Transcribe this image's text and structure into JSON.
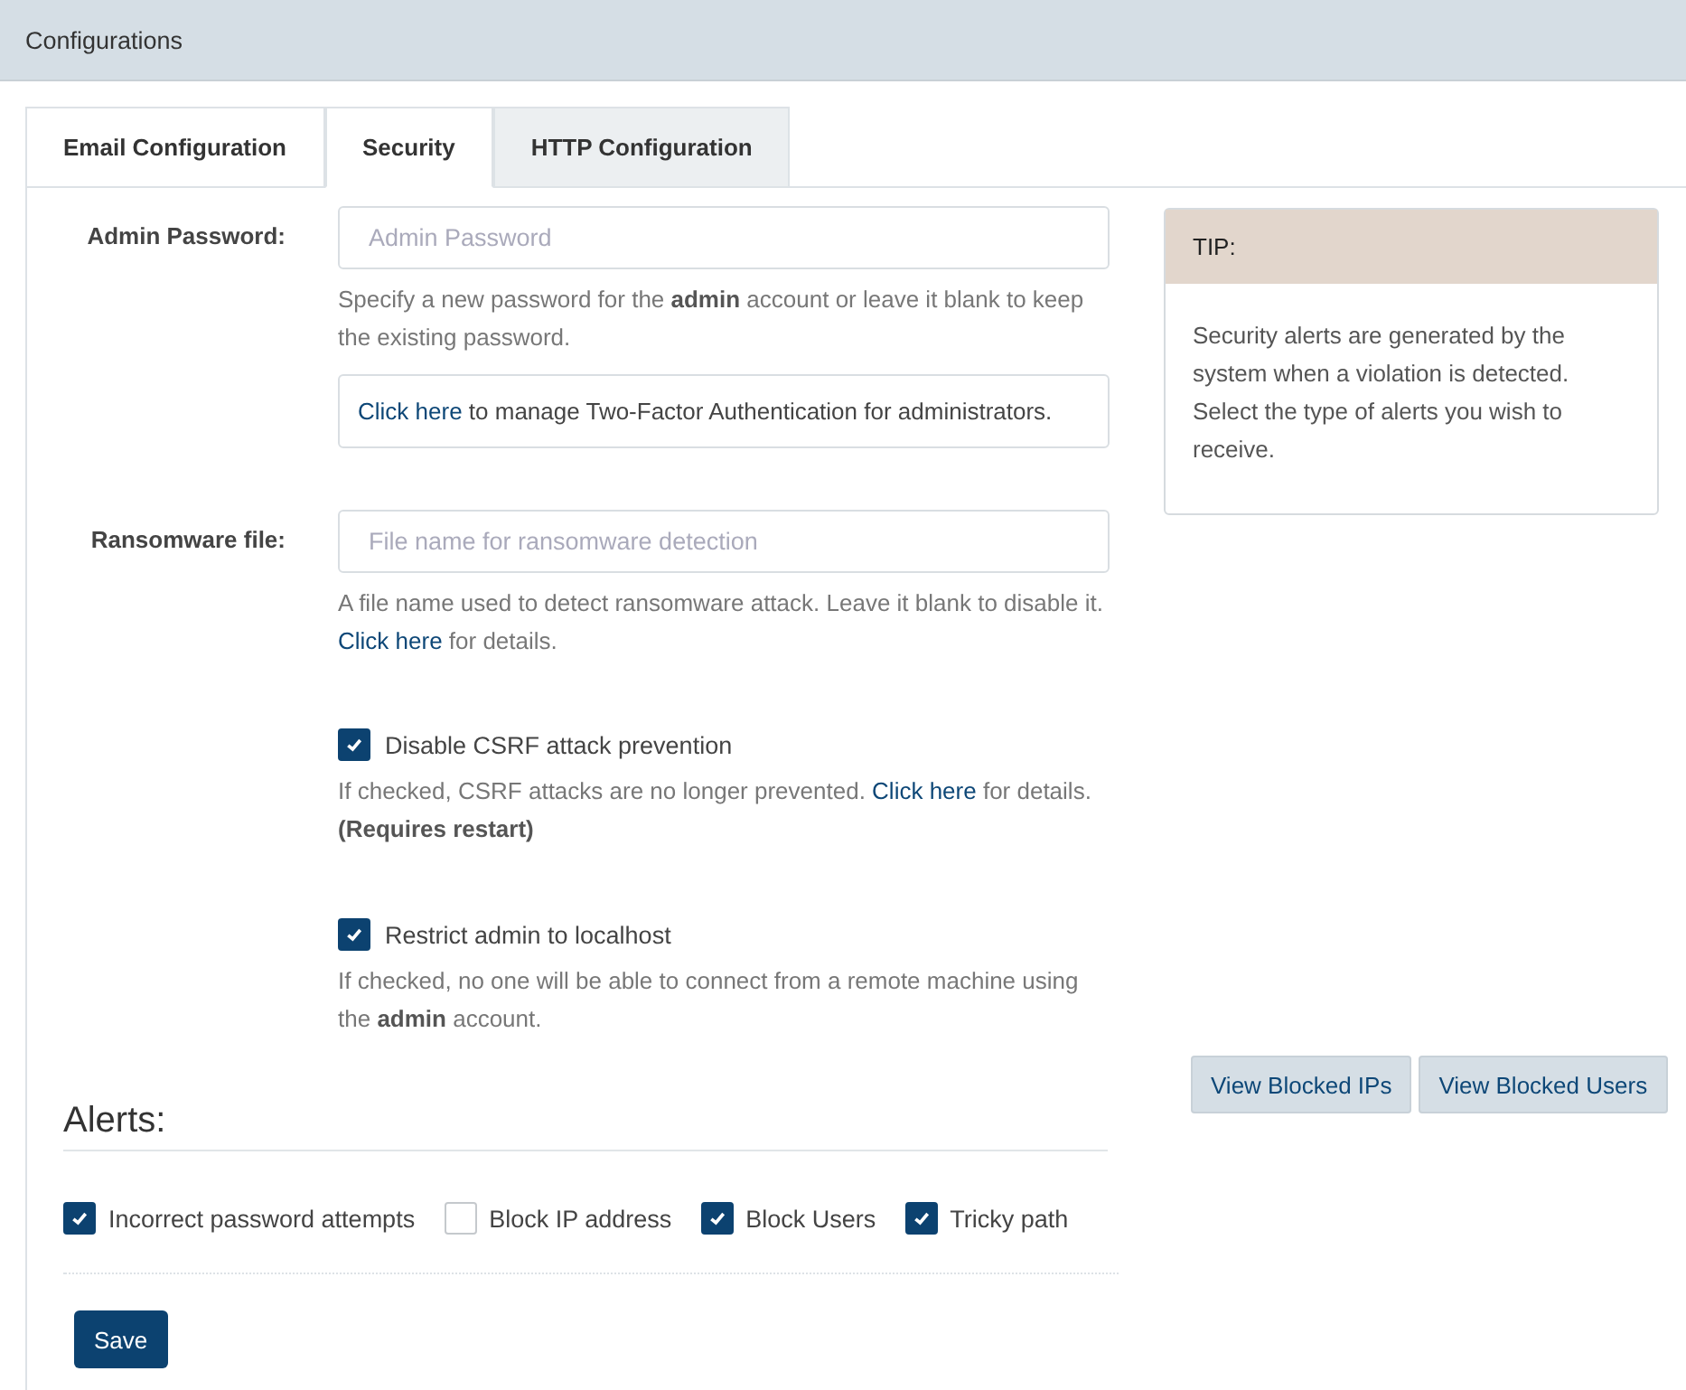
{
  "header": {
    "title": "Configurations"
  },
  "tabs": [
    {
      "label": "Email Configuration",
      "selected": false
    },
    {
      "label": "Security",
      "selected": true
    },
    {
      "label": "HTTP Configuration",
      "selected": false
    }
  ],
  "fields": [
    {
      "kind": "input",
      "label": "Admin Password:",
      "placeholder": "Admin Password",
      "help": [
        {
          "kind": "text",
          "text": "Specify a new password for the **admin** account or leave it blank to keep the existing password."
        }
      ],
      "notice": [
        {
          "kind": "link",
          "text": "Click here"
        },
        {
          "kind": "text",
          "text": " to manage Two-Factor Authentication for administrators."
        }
      ]
    },
    {
      "kind": "input",
      "label": "Ransomware file:",
      "placeholder": "File name for ransomware detection",
      "help": [
        {
          "kind": "text",
          "text": "A file name used to detect ransomware attack. Leave it blank to disable it. "
        },
        {
          "kind": "link",
          "text": "Click here"
        },
        {
          "kind": "text",
          "text": " for details."
        }
      ]
    },
    {
      "kind": "checkbox",
      "label": "Disable CSRF attack prevention",
      "checked": true,
      "help": [
        {
          "kind": "text",
          "text": "If checked, CSRF attacks are no longer prevented. "
        },
        {
          "kind": "link",
          "text": "Click here"
        },
        {
          "kind": "text",
          "text": " for details. **(Requires restart)**"
        }
      ]
    },
    {
      "kind": "checkbox",
      "label": "Restrict admin to localhost",
      "checked": true,
      "help": [
        {
          "kind": "text",
          "text": "If checked, no one will be able to connect from a remote machine using the **admin** account."
        }
      ]
    }
  ],
  "alerts": {
    "title": "Alerts:",
    "options": [
      {
        "label": "Incorrect password attempts",
        "checked": true
      },
      {
        "label": "Block IP address",
        "checked": false
      },
      {
        "label": "Block Users",
        "checked": true
      },
      {
        "label": "Tricky path",
        "checked": true
      }
    ]
  },
  "save_button": "Save",
  "tip": {
    "title": "TIP:",
    "text": "Security alerts are generated by the system when a violation is detected. Select the type of alerts you wish to receive."
  },
  "side_buttons": [
    "View Blocked IPs",
    "View Blocked Users"
  ]
}
